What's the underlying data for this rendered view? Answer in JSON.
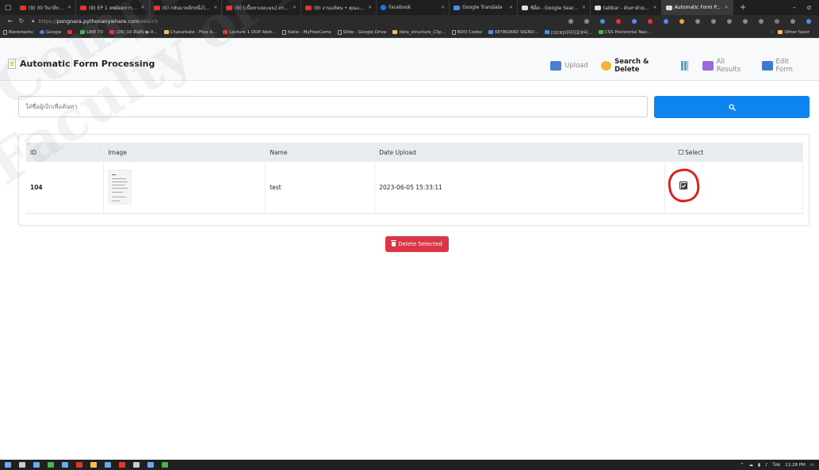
{
  "browser": {
    "tabs": [
      {
        "label": "(9) 30 วินาทีก...",
        "icon": "youtube-icon"
      },
      {
        "label": "(9) EP 1 ลพผ้มดการ...",
        "icon": "youtube-icon"
      },
      {
        "label": "(9) กลับมาหลีกหนึ่งไ...",
        "icon": "youtube-icon"
      },
      {
        "label": "(9) [เนื้อหาเยอะมน] คร...",
        "icon": "youtube-icon"
      },
      {
        "label": "(9) งานแท้ตน • คุณแ...",
        "icon": "youtube-icon"
      },
      {
        "label": "Facebook",
        "icon": "facebook-icon"
      },
      {
        "label": "Google Translate",
        "icon": "translate-icon"
      },
      {
        "label": "ซิต็ต - Google Sear...",
        "icon": "google-icon"
      },
      {
        "label": "tabbar - ค้นหาด้วย...",
        "icon": "google-icon"
      },
      {
        "label": "Automatic Form P...",
        "icon": "page-icon",
        "active": true
      }
    ],
    "url_scheme": "https://",
    "url_host": "pongnara.pythonanywhere.com",
    "url_path": "/search",
    "bookmarks": [
      "Bookmarks",
      "Google",
      "",
      "LINE TV",
      "(26) 10 อันดับ ▶ ส...",
      "Chaturbate - Free A...",
      "Lecture 1 OOP Abst...",
      "Katie - MyFreeCams",
      "Slide - Google Drive",
      "data_structure_Clip...",
      "BDO Codex",
      "KEYBOARD SIGNO...",
      "[OCR]이미지로부터...",
      "CSS Horizontal Nav..."
    ],
    "other_bookmarks": "Other favor"
  },
  "header": {
    "brand": "Automatic Form Processing",
    "nav": [
      {
        "label": "Upload",
        "icon": "upload-icon",
        "active": false
      },
      {
        "label": "Search & Delete",
        "icon": "search-delete-icon",
        "active": true
      },
      {
        "label": "All Results",
        "icon": "results-icon",
        "active": false
      },
      {
        "label": "Edit Form",
        "icon": "edit-form-icon",
        "active": false
      }
    ]
  },
  "search": {
    "placeholder": "ใส่ชื่อผู้เบิกเพื่อค้นหา",
    "button_icon": "search-icon"
  },
  "table": {
    "columns": [
      "ID",
      "Image",
      "Name",
      "Date Upload",
      "Select"
    ],
    "rows": [
      {
        "id": "104",
        "name": "test",
        "date": "2023-06-05 15:33:11",
        "selected": true
      }
    ]
  },
  "actions": {
    "delete_label": "Delete Selected"
  },
  "watermark": {
    "line1": "Computer Science,",
    "line2": "Faculty of Informatics"
  },
  "taskbar": {
    "clock": "11:28 PM",
    "lang": "ไทย"
  },
  "colors": {
    "primary": "#0d84f0",
    "danger": "#dc3545",
    "annotation": "#e01f1f"
  }
}
